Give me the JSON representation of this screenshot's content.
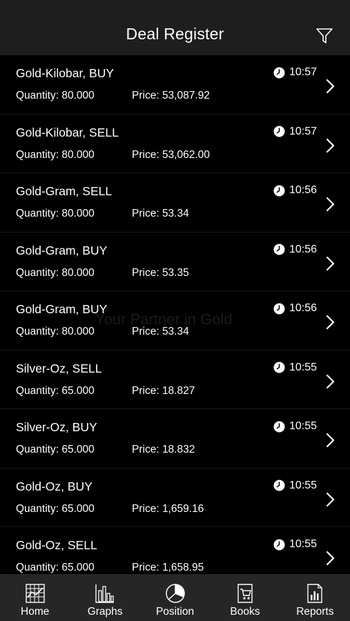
{
  "header": {
    "title": "Deal Register",
    "filter_icon": "filter-icon"
  },
  "labels": {
    "quantity": "Quantity:",
    "price": "Price:"
  },
  "watermark": {
    "tagline": "Your Partner in Gold"
  },
  "deals": [
    {
      "title": "Gold-Kilobar,  BUY",
      "time": "10:57",
      "quantity": "80.000",
      "price": "53,087.92"
    },
    {
      "title": "Gold-Kilobar,  SELL",
      "time": "10:57",
      "quantity": "80.000",
      "price": "53,062.00"
    },
    {
      "title": "Gold-Gram,  SELL",
      "time": "10:56",
      "quantity": "80.000",
      "price": "53.34"
    },
    {
      "title": "Gold-Gram,  BUY",
      "time": "10:56",
      "quantity": "80.000",
      "price": "53.35"
    },
    {
      "title": "Gold-Gram,  BUY",
      "time": "10:56",
      "quantity": "80.000",
      "price": "53.34"
    },
    {
      "title": "Silver-Oz,  SELL",
      "time": "10:55",
      "quantity": "65.000",
      "price": "18.827"
    },
    {
      "title": "Silver-Oz,  BUY",
      "time": "10:55",
      "quantity": "65.000",
      "price": "18.832"
    },
    {
      "title": "Gold-Oz,  BUY",
      "time": "10:55",
      "quantity": "65.000",
      "price": "1,659.16"
    },
    {
      "title": "Gold-Oz,  SELL",
      "time": "10:55",
      "quantity": "65.000",
      "price": "1,658.95"
    }
  ],
  "tabs": [
    {
      "label": "Home",
      "icon": "home-grid-icon"
    },
    {
      "label": "Graphs",
      "icon": "bar-graph-icon"
    },
    {
      "label": "Position",
      "icon": "pie-chart-icon"
    },
    {
      "label": "Books",
      "icon": "cart-book-icon"
    },
    {
      "label": "Reports",
      "icon": "report-icon"
    }
  ]
}
